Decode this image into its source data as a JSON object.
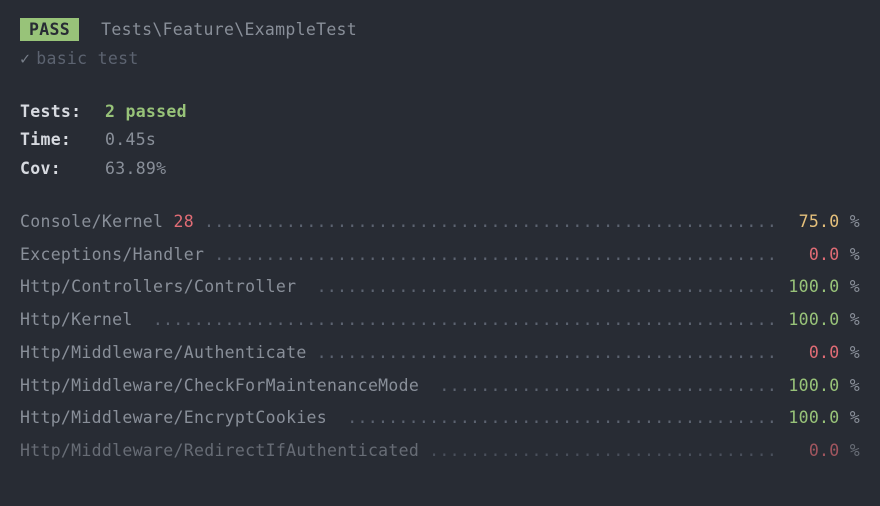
{
  "header": {
    "badge": "PASS",
    "test_path": "Tests\\Feature\\ExampleTest",
    "check_mark": "✓",
    "test_name": "basic test"
  },
  "summary": {
    "tests_label": "Tests:",
    "tests_value": "2 passed",
    "time_label": "Time:",
    "time_value": "0.45s",
    "cov_label": "Cov:",
    "cov_value": "63.89%"
  },
  "dots": ".........................................................................................................",
  "pct_symbol": " %",
  "coverage": [
    {
      "path": "Console/Kernel",
      "lines": " 28",
      "pct": "75.0",
      "level": "mid"
    },
    {
      "path": "Exceptions/Handler",
      "lines": "",
      "pct": "0.0",
      "level": "low"
    },
    {
      "path": "Http/Controllers/Controller ",
      "lines": "",
      "pct": "100.0",
      "level": "high"
    },
    {
      "path": "Http/Kernel ",
      "lines": "",
      "pct": "100.0",
      "level": "high"
    },
    {
      "path": "Http/Middleware/Authenticate",
      "lines": "",
      "pct": "0.0",
      "level": "low"
    },
    {
      "path": "Http/Middleware/CheckForMaintenanceMode ",
      "lines": "",
      "pct": "100.0",
      "level": "high"
    },
    {
      "path": "Http/Middleware/EncryptCookies ",
      "lines": "",
      "pct": "100.0",
      "level": "high"
    },
    {
      "path": "Http/Middleware/RedirectIfAuthenticated",
      "lines": "",
      "pct": "0.0",
      "level": "low",
      "cutoff": true
    }
  ]
}
